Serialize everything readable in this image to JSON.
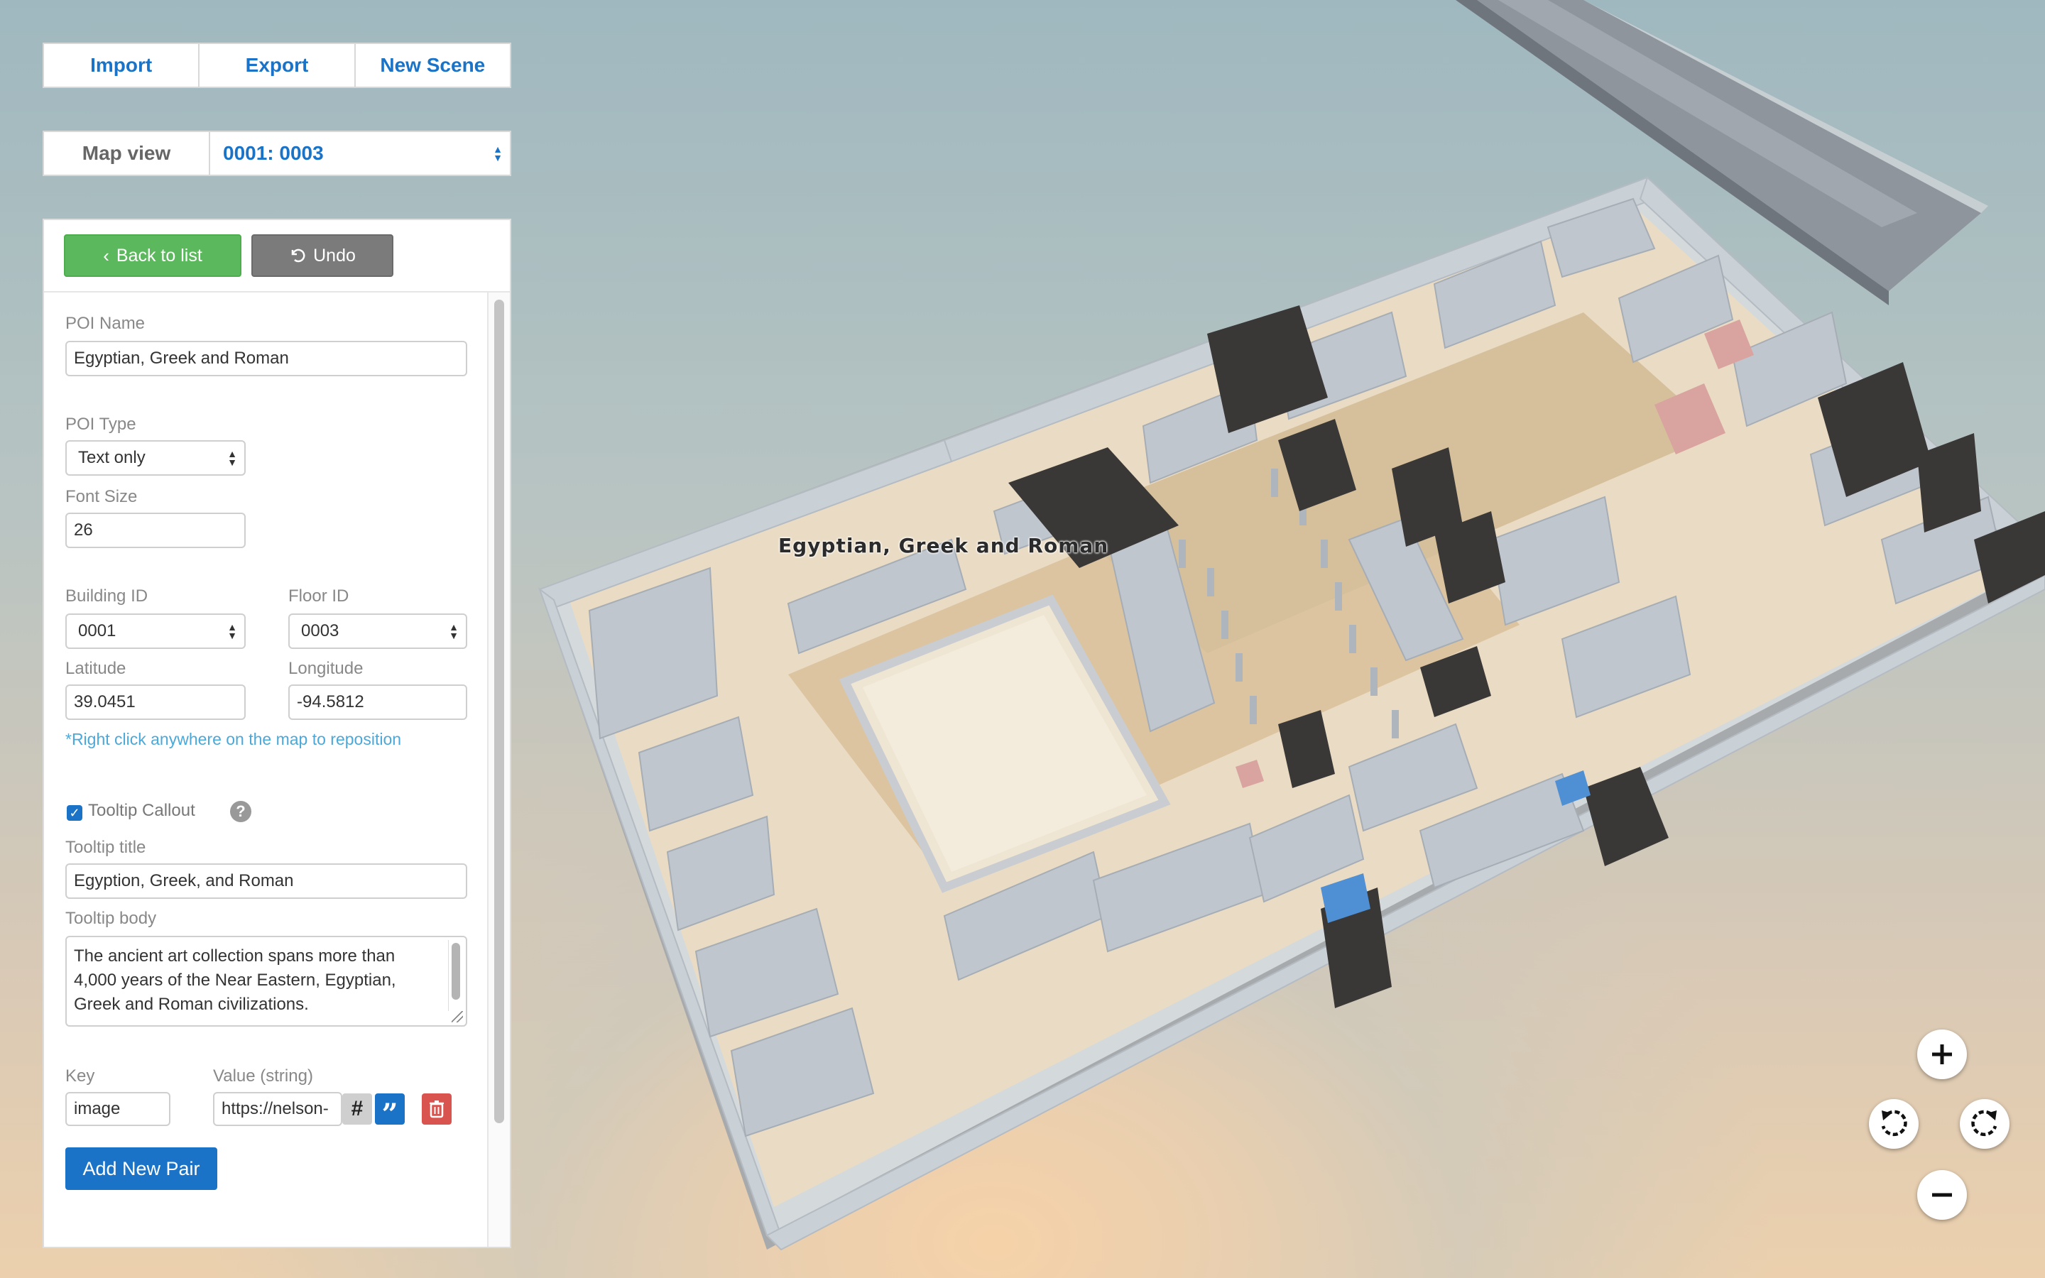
{
  "toolbar": {
    "import_label": "Import",
    "export_label": "Export",
    "new_scene_label": "New Scene"
  },
  "map_view": {
    "label": "Map view",
    "selected": "0001: 0003"
  },
  "panel": {
    "back_label": "Back to list",
    "undo_label": "Undo",
    "poi_name_label": "POI Name",
    "poi_name_value": "Egyptian, Greek and Roman",
    "poi_type_label": "POI Type",
    "poi_type_value": "Text only",
    "font_size_label": "Font Size",
    "font_size_value": "26",
    "building_id_label": "Building ID",
    "building_id_value": "0001",
    "floor_id_label": "Floor ID",
    "floor_id_value": "0003",
    "latitude_label": "Latitude",
    "latitude_value": "39.0451",
    "longitude_label": "Longitude",
    "longitude_value": "-94.5812",
    "reposition_hint": "*Right click anywhere on the map to reposition",
    "tooltip_callout_label": "Tooltip Callout",
    "tooltip_callout_checked": true,
    "tooltip_title_label": "Tooltip title",
    "tooltip_title_value": "Egyption, Greek, and Roman",
    "tooltip_body_label": "Tooltip body",
    "tooltip_body_value": "The ancient art collection spans more than 4,000 years of the Near Eastern, Egyptian, Greek and Roman civilizations.",
    "key_label": "Key",
    "key_value": "image",
    "value_label": "Value (string)",
    "value_value": "https://nelson-",
    "add_pair_label": "Add New Pair"
  },
  "map": {
    "poi_label": "Egyptian, Greek and Roman"
  },
  "colors": {
    "accent": "#1a73c7",
    "success": "#5cb85c",
    "danger": "#d9534f",
    "neutral": "#7b7b7b"
  }
}
